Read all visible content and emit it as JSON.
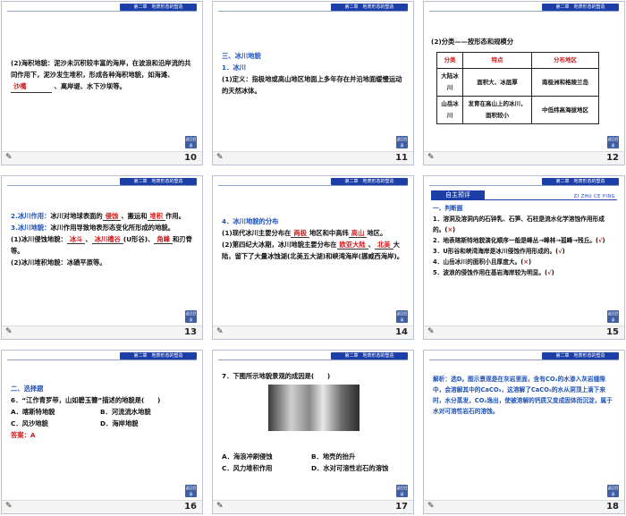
{
  "header_label": "第二章　地表形态的塑造",
  "back_label": "返回目录",
  "slides": [
    {
      "num": "10",
      "lines": [
        {
          "a": "(2)海积地貌：泥沙未沉积较丰富的海岸，在波浪和沿岸流的共同作用下，泥沙发生堆积，形成各种海积地貌，如海滩、"
        },
        {
          "fill": "沙嘴"
        },
        {
          "a": "、离岸堤、水下沙坝等。"
        }
      ]
    },
    {
      "num": "11",
      "title": "三、冰川地貌",
      "sub": "1．冰川",
      "text": "(1)定义：指极地或高山地区地面上多年存在并沿地面缓慢运动的天然冰体。"
    },
    {
      "num": "12",
      "caption": "(2)分类——按形态和规模分",
      "table": {
        "headers": [
          "分类",
          "特点",
          "分布地区"
        ],
        "rows": [
          [
            "大陆冰川",
            "面积大、冰层厚",
            "南极洲和格陵兰岛"
          ],
          [
            "山岳冰川",
            "发育在高山上的冰川，面积较小",
            "中低纬高海拔地区"
          ]
        ]
      }
    },
    {
      "num": "13",
      "p1a": "2.",
      "p1b": "冰川作用：",
      "p1c": "冰川对地球表面的",
      "f1": "侵蚀",
      "p1d": "、搬运和",
      "f2": "堆积",
      "p1e": "作用。",
      "p2a": "3.",
      "p2b": "冰川地貌：",
      "p2c": "冰川作用导致地表形态变化所形成的地貌。",
      "p3": "(1)冰川侵蚀地貌：",
      "f3": "冰斗",
      "f4": "冰川槽谷",
      "p3b": "(U形谷)、",
      "f5": "角峰",
      "p3c": "和刃脊等。",
      "p4": "(2)冰川堆积地貌：冰碛平原等。"
    },
    {
      "num": "14",
      "title": "4．冰川地貌的分布",
      "t1a": "(1)现代冰川主要分布在",
      "f1": "两极",
      "t1b": "地区和中高纬",
      "f2": "高山",
      "t1c": "地区。",
      "t2a": "(2)第四纪大冰期，冰川地貌主要分布在",
      "f3": "欧亚大陆",
      "t2b": "、",
      "f4": "北美",
      "t2c": "大陆，留下了大量冰蚀湖(北美五大湖)和峡湾海岸(挪威西海岸)。"
    },
    {
      "num": "15",
      "banner": "自主预评",
      "pinyin": "ZI ZHU CE PING",
      "section": "一、判断题",
      "items": [
        {
          "t": "1．溶洞及溶洞内的石钟乳、石笋、石柱是流水化学溶蚀作用形成的。(",
          "m": "×",
          "e": ")"
        },
        {
          "t": "2．地表喀斯特地貌演化顺序一般是峰丛→峰林→孤峰→残丘。(",
          "m": "√",
          "e": ")"
        },
        {
          "t": "3．U形谷和峡湾海岸是冰川侵蚀作用形成的。(",
          "m": "√",
          "e": ")"
        },
        {
          "t": "4．山岳冰川的面积小且厚度大。(",
          "m": "×",
          "e": ")"
        },
        {
          "t": "5．波浪的侵蚀作用在基岩海岸较为明显。(",
          "m": "√",
          "e": ")"
        }
      ]
    },
    {
      "num": "16",
      "section": "二、选择题",
      "q": "6．“江作青罗带，山如碧玉簪”描述的地貌是(　　)",
      "opts": [
        "A．喀斯特地貌",
        "B．河流流水地貌",
        "C．风沙地貌",
        "D．海岸地貌"
      ],
      "ans": "答案：A"
    },
    {
      "num": "17",
      "q": "7．下图所示地貌景观的成因是(　　)",
      "opts": [
        "A．海浪冲刷侵蚀",
        "B．地壳的抬升",
        "C．风力堆积作用",
        "D．水对可溶性岩石的溶蚀"
      ]
    },
    {
      "num": "18",
      "text": "解析：选D。图示景观是在灰岩里面，含有CO₂的水渗入灰岩缝隙中，会溶解其中的CaCO₃，这溶解了CaCO₃的水从洞顶上滴下来时，水分蒸发，CO₂逸出，使被溶解的钙质又变成固体而沉淀，属于水对可溶性岩石的溶蚀。"
    }
  ]
}
